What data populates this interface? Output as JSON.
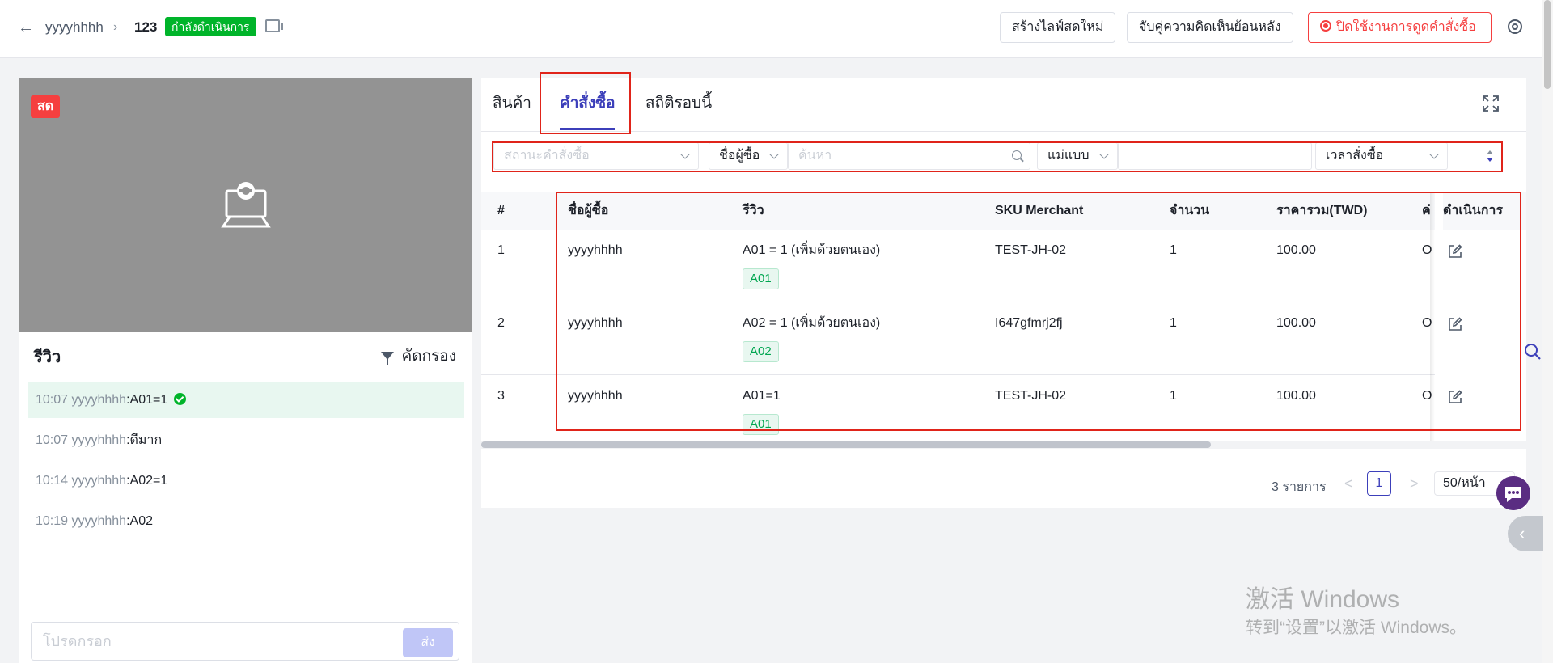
{
  "header": {
    "crumb_user": "yyyyhhhh",
    "crumb_id": "123",
    "status": "กำลังดำเนินการ",
    "btn_new_live": "สร้างไลฟ์สดใหม่",
    "btn_pair_comments": "จับคู่ความคิดเห็นย้อนหลัง",
    "btn_disable_orders": "ปิดใช้งานการดูดคำสั่งซื้อ"
  },
  "video": {
    "live_label": "สด"
  },
  "chat": {
    "title": "รีวิว",
    "filter_label": "คัดกรอง",
    "messages": [
      {
        "time": "10:07 yyyyhhhh",
        "text": ":A01=1"
      },
      {
        "time": "10:07 yyyyhhhh",
        "text": ":ดีมาก"
      },
      {
        "time": "10:14 yyyyhhhh",
        "text": ":A02=1"
      },
      {
        "time": "10:19 yyyyhhhh",
        "text": ":A02"
      }
    ],
    "input_placeholder": "โปรดกรอก",
    "send_label": "ส่ง"
  },
  "tabs": [
    {
      "label": "สินค้า"
    },
    {
      "label": "คำสั่งซื้อ"
    },
    {
      "label": "สถิติรอบนี้"
    }
  ],
  "filters": {
    "order_status": "สถานะคำสั่งซื้อ",
    "buyer_name": "ชื่อผู้ซื้อ",
    "search_placeholder": "ค้นหา",
    "template": "แม่แบบ",
    "order_time": "เวลาสั่งซื้อ"
  },
  "table": {
    "columns": [
      "#",
      "ชื่อผู้ซื้อ",
      "รีวิว",
      "SKU Merchant",
      "จำนวน",
      "ราคารวม(TWD)",
      "ค่",
      "ดำเนินการ"
    ],
    "rows": [
      {
        "num": "1",
        "buyer": "yyyyhhhh",
        "review": "A01 = 1 (เพิ่มด้วยตนเอง)",
        "tag": "A01",
        "sku": "TEST-JH-02",
        "qty": "1",
        "total": "100.00",
        "extra": "O"
      },
      {
        "num": "2",
        "buyer": "yyyyhhhh",
        "review": "A02 = 1 (เพิ่มด้วยตนเอง)",
        "tag": "A02",
        "sku": "I647gfmrj2fj",
        "qty": "1",
        "total": "100.00",
        "extra": "O"
      },
      {
        "num": "3",
        "buyer": "yyyyhhhh",
        "review": "A01=1",
        "tag": "A01",
        "sku": "TEST-JH-02",
        "qty": "1",
        "total": "100.00",
        "extra": "O"
      }
    ]
  },
  "pagination": {
    "total": "3 รายการ",
    "prev": "<",
    "page": "1",
    "next": ">",
    "page_size": "50/หน้า"
  },
  "collapse_glyph": "‹",
  "watermark": {
    "line1": "激活 Windows",
    "line2": "转到“设置”以激活 Windows。"
  },
  "colors": {
    "accent": "#3c3fba",
    "status_green": "#00b42a",
    "danger": "#f53f3f",
    "annotation_red": "#e0241a"
  }
}
